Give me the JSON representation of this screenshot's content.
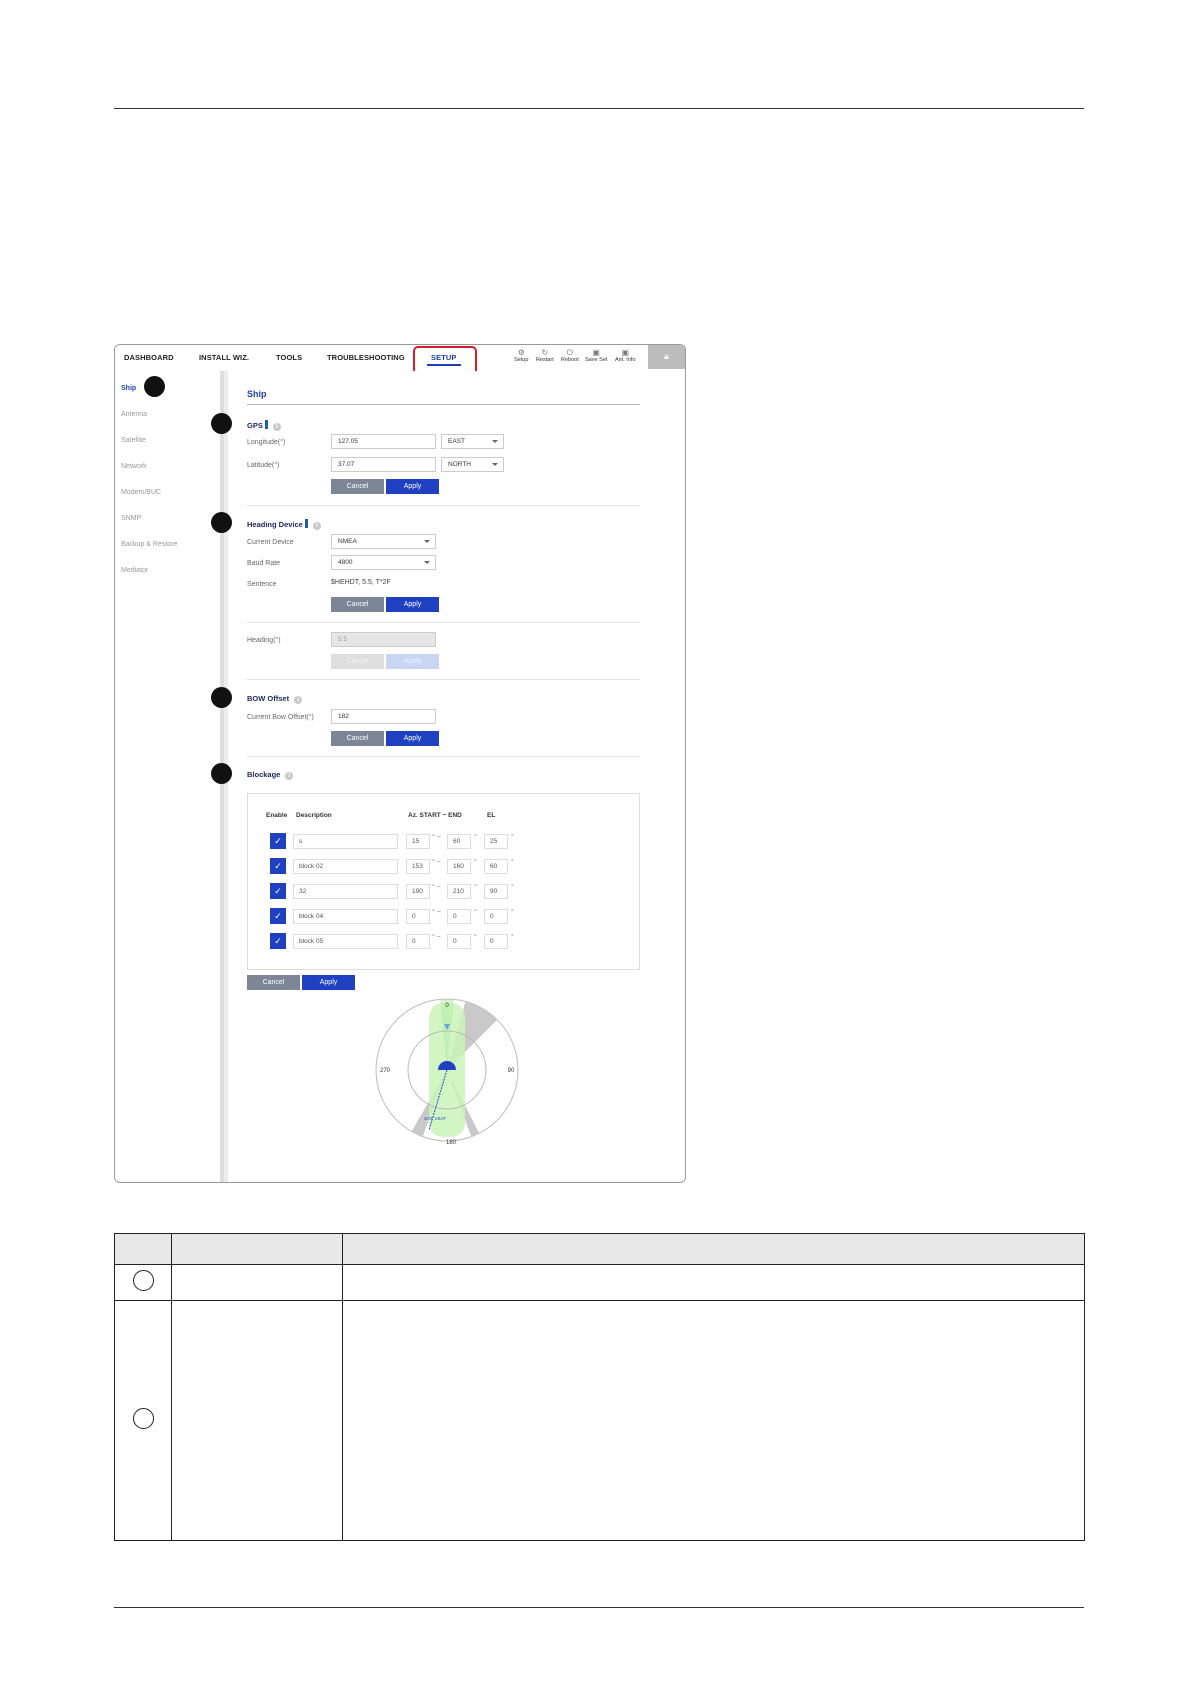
{
  "topbar": {
    "nav": [
      "DASHBOARD",
      "INSTALL WIZ.",
      "TOOLS",
      "TROUBLESHOOTING",
      "SETUP"
    ],
    "active": "SETUP",
    "tools": [
      "Setup",
      "Restart",
      "Reboot",
      "Save Set",
      "Ant. Info"
    ]
  },
  "sidebar": {
    "items": [
      "Ship",
      "Antenna",
      "Satellite",
      "Network",
      "Modem/BUC",
      "SNMP",
      "Backup & Restore",
      "Mediator"
    ],
    "active": "Ship"
  },
  "page": {
    "title": "Ship"
  },
  "gps": {
    "title": "GPS",
    "longitude_label": "Longitude(°)",
    "longitude_value": "127.05",
    "longitude_dir": "EAST",
    "latitude_label": "Latitude(°)",
    "latitude_value": "37.07",
    "latitude_dir": "NORTH",
    "cancel": "Cancel",
    "apply": "Apply"
  },
  "heading_device": {
    "title": "Heading Device",
    "current_device_label": "Current Device",
    "current_device_value": "NMEA",
    "baud_rate_label": "Baud Rate",
    "baud_rate_value": "4800",
    "sentence_label": "Sentence",
    "sentence_value": "$HEHDT, 5.5, T*2F",
    "cancel": "Cancel",
    "apply": "Apply"
  },
  "heading": {
    "label": "Heading(°)",
    "value": "5.5",
    "cancel": "Cancel",
    "apply": "Apply"
  },
  "bow_offset": {
    "title": "BOW Offset",
    "label": "Current Bow Offset(°)",
    "value": "182",
    "cancel": "Cancel",
    "apply": "Apply"
  },
  "blockage": {
    "title": "Blockage",
    "headers": {
      "enable": "Enable",
      "description": "Description",
      "az": "Az. START ~ END",
      "el": "EL"
    },
    "rows": [
      {
        "enabled": true,
        "description": "s",
        "start": "15",
        "end": "60",
        "el": "25"
      },
      {
        "enabled": true,
        "description": "block 02",
        "start": "153",
        "end": "160",
        "el": "60"
      },
      {
        "enabled": true,
        "description": "32",
        "start": "190",
        "end": "210",
        "el": "90"
      },
      {
        "enabled": true,
        "description": "block 04",
        "start": "0",
        "end": "0",
        "el": "0"
      },
      {
        "enabled": true,
        "description": "block 05",
        "start": "0",
        "end": "0",
        "el": "0"
      }
    ],
    "cancel": "Cancel",
    "apply": "Apply"
  },
  "radar": {
    "labels": {
      "n": "0",
      "e": "90",
      "s": "180",
      "w": "270",
      "sat": "SAT.  VSAT"
    },
    "colors": {
      "ship": "#c9f5b8",
      "blockage": "#bdbdbd",
      "antenna": "#1f40c0"
    }
  }
}
